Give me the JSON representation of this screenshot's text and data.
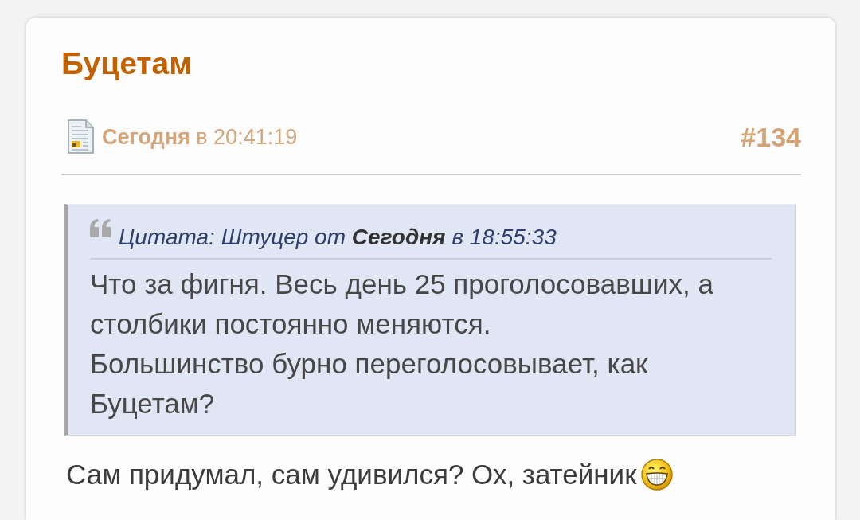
{
  "post": {
    "title": "Буцетам",
    "date": "**Сегодня** в 20:41:19",
    "number": "#134",
    "quote": {
      "header": "Цитата: Штуцер от **Сегодня** в 18:55:33",
      "paragraphs": [
        "Что за фигня. Весь день 25 проголосовавших, а столбики постоянно меняются.",
        "Большинство бурно переголосовывает, как Буцетам?"
      ]
    },
    "message": "Сам придумал, сам удивился? Ох, затейник"
  }
}
